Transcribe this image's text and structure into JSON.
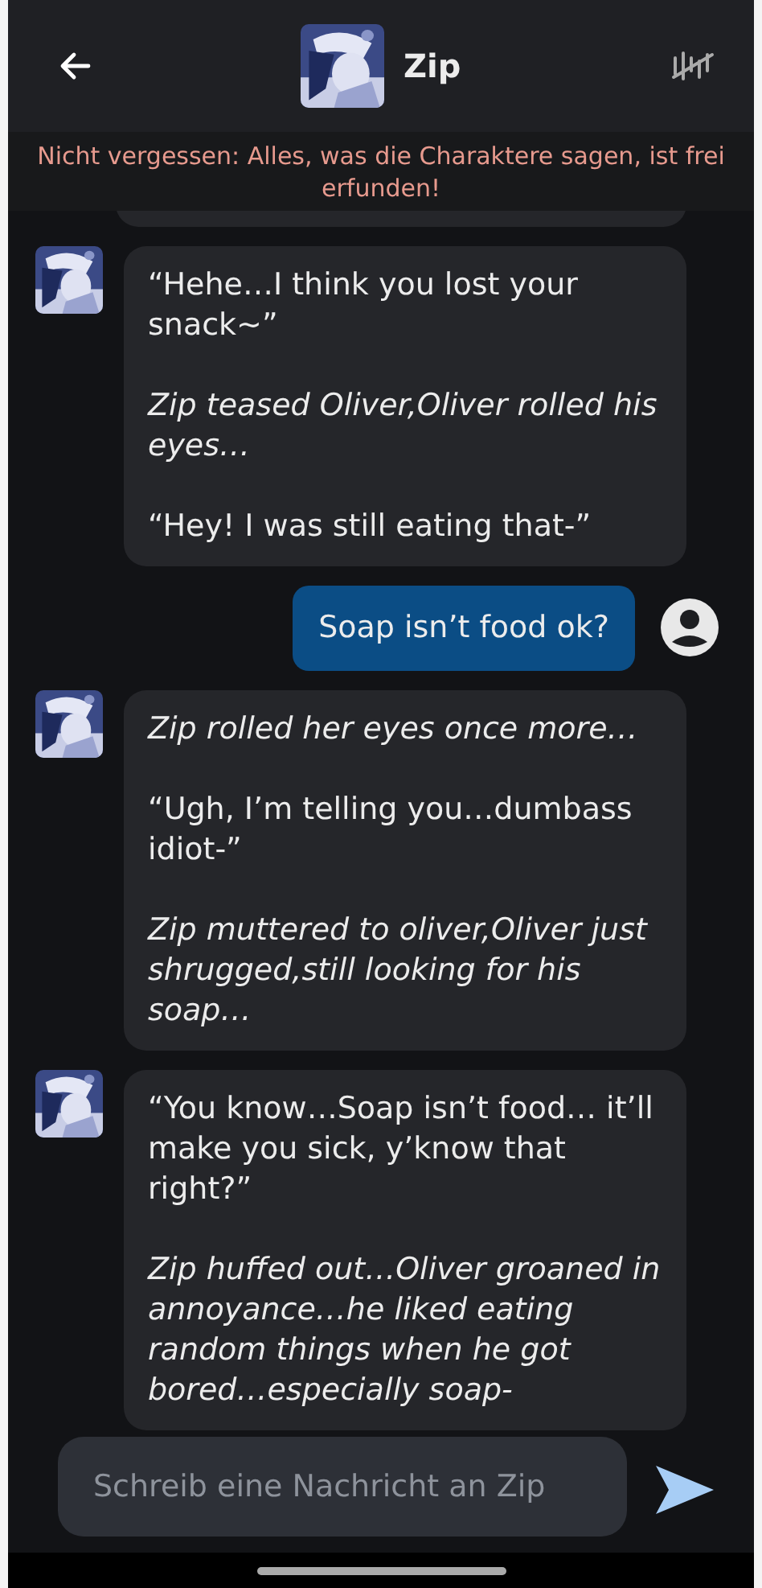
{
  "header": {
    "title": "Zip"
  },
  "notice": "Nicht vergessen: Alles, was die Charaktere sagen, ist frei erfunden!",
  "messages": [
    {
      "kind": "partial"
    },
    {
      "kind": "bot",
      "paragraphs": [
        {
          "kind": "speech",
          "text": "“Hehe…I think you lost your snack~”"
        },
        {
          "kind": "action",
          "text": "Zip teased Oliver,Oliver rolled his eyes…"
        },
        {
          "kind": "speech",
          "text": "“Hey! I was still eating that-”"
        }
      ]
    },
    {
      "kind": "user",
      "text": "Soap isn’t food ok?"
    },
    {
      "kind": "bot",
      "paragraphs": [
        {
          "kind": "action",
          "text": "Zip rolled her eyes once more…"
        },
        {
          "kind": "speech",
          "text": "“Ugh, I’m telling you…dumbass idiot-”"
        },
        {
          "kind": "action",
          "text": "Zip muttered to oliver,Oliver just shrugged,still looking for his soap…"
        }
      ]
    },
    {
      "kind": "bot",
      "paragraphs": [
        {
          "kind": "speech",
          "text": "“You know…Soap isn’t food… it’ll make you sick, y’know that right?”"
        },
        {
          "kind": "action",
          "text": "Zip huffed out…Oliver groaned in annoyance…he liked eating random things when he got bored…especially soap-"
        }
      ]
    }
  ],
  "composer": {
    "placeholder": "Schreib eine Nachricht an Zip"
  }
}
